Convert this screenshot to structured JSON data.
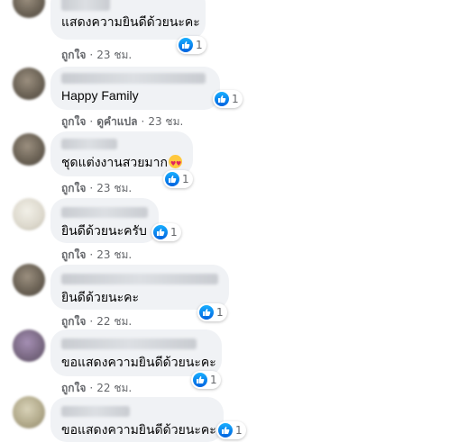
{
  "comments": [
    {
      "name": "[blurred name]",
      "text": "แสดงความยินดีด้วยนะคะ",
      "reactions": "1",
      "actions": {
        "like": "ถูกใจ",
        "time": "23 ชม."
      }
    },
    {
      "name": "[blurred name]",
      "text": "Happy Family",
      "reactions": "1",
      "actions": {
        "like": "ถูกใจ",
        "translate": "ดูคำแปล",
        "time": "23 ชม."
      }
    },
    {
      "name": "[blurred name]",
      "text": "ชุดแต่งงานสวยมาก",
      "emoji": "heart-eyes-emoji",
      "reactions": "1",
      "actions": {
        "like": "ถูกใจ",
        "time": "23 ชม."
      }
    },
    {
      "name": "[blurred name]",
      "text": "ยินดีด้วยนะครับ",
      "reactions": "1",
      "actions": {
        "like": "ถูกใจ",
        "time": "23 ชม."
      }
    },
    {
      "name": "[blurred name]",
      "text": "ยินดีด้วยนะคะ",
      "reactions": "1",
      "actions": {
        "like": "ถูกใจ",
        "time": "22 ชม."
      }
    },
    {
      "name": "[blurred name]",
      "text": "ขอแสดงความยินดีด้วยนะคะ",
      "reactions": "1",
      "actions": {
        "like": "ถูกใจ",
        "time": "22 ชม."
      }
    },
    {
      "name": "[blurred name]",
      "text": "ขอแสดงความยินดีด้วยนะคะ",
      "reactions": "1",
      "actions": {}
    }
  ],
  "colors": {
    "bubble": "#f0f2f5",
    "like_blue": "#1877f2",
    "meta_text": "#65676b"
  }
}
